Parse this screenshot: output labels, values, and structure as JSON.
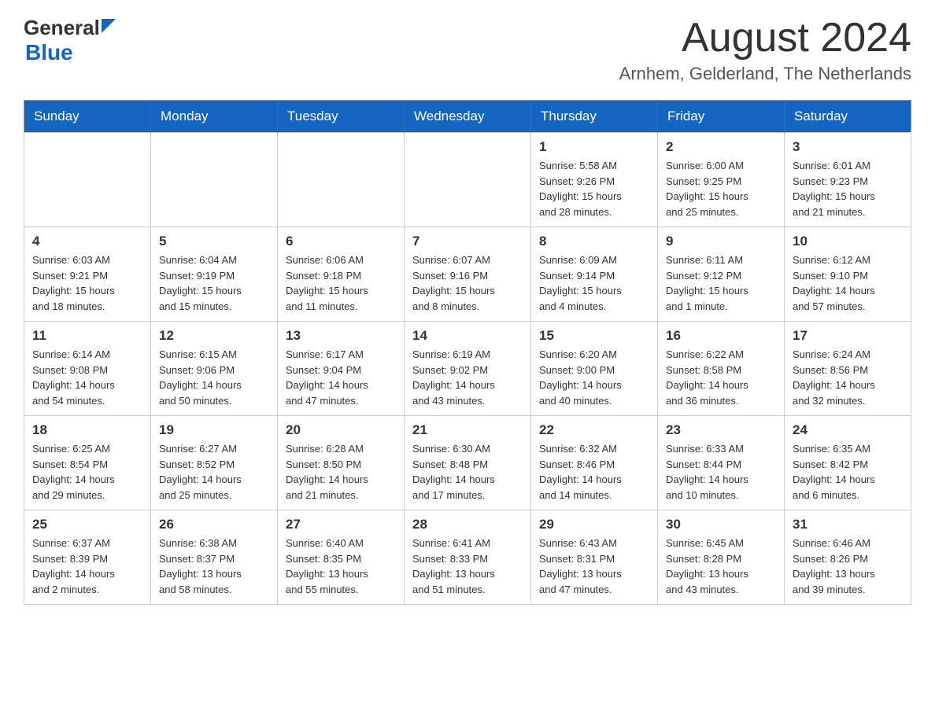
{
  "logo": {
    "general": "General",
    "blue": "Blue"
  },
  "header": {
    "month_title": "August 2024",
    "location": "Arnhem, Gelderland, The Netherlands"
  },
  "days_of_week": [
    "Sunday",
    "Monday",
    "Tuesday",
    "Wednesday",
    "Thursday",
    "Friday",
    "Saturday"
  ],
  "weeks": [
    [
      {
        "day": "",
        "info": ""
      },
      {
        "day": "",
        "info": ""
      },
      {
        "day": "",
        "info": ""
      },
      {
        "day": "",
        "info": ""
      },
      {
        "day": "1",
        "info": "Sunrise: 5:58 AM\nSunset: 9:26 PM\nDaylight: 15 hours\nand 28 minutes."
      },
      {
        "day": "2",
        "info": "Sunrise: 6:00 AM\nSunset: 9:25 PM\nDaylight: 15 hours\nand 25 minutes."
      },
      {
        "day": "3",
        "info": "Sunrise: 6:01 AM\nSunset: 9:23 PM\nDaylight: 15 hours\nand 21 minutes."
      }
    ],
    [
      {
        "day": "4",
        "info": "Sunrise: 6:03 AM\nSunset: 9:21 PM\nDaylight: 15 hours\nand 18 minutes."
      },
      {
        "day": "5",
        "info": "Sunrise: 6:04 AM\nSunset: 9:19 PM\nDaylight: 15 hours\nand 15 minutes."
      },
      {
        "day": "6",
        "info": "Sunrise: 6:06 AM\nSunset: 9:18 PM\nDaylight: 15 hours\nand 11 minutes."
      },
      {
        "day": "7",
        "info": "Sunrise: 6:07 AM\nSunset: 9:16 PM\nDaylight: 15 hours\nand 8 minutes."
      },
      {
        "day": "8",
        "info": "Sunrise: 6:09 AM\nSunset: 9:14 PM\nDaylight: 15 hours\nand 4 minutes."
      },
      {
        "day": "9",
        "info": "Sunrise: 6:11 AM\nSunset: 9:12 PM\nDaylight: 15 hours\nand 1 minute."
      },
      {
        "day": "10",
        "info": "Sunrise: 6:12 AM\nSunset: 9:10 PM\nDaylight: 14 hours\nand 57 minutes."
      }
    ],
    [
      {
        "day": "11",
        "info": "Sunrise: 6:14 AM\nSunset: 9:08 PM\nDaylight: 14 hours\nand 54 minutes."
      },
      {
        "day": "12",
        "info": "Sunrise: 6:15 AM\nSunset: 9:06 PM\nDaylight: 14 hours\nand 50 minutes."
      },
      {
        "day": "13",
        "info": "Sunrise: 6:17 AM\nSunset: 9:04 PM\nDaylight: 14 hours\nand 47 minutes."
      },
      {
        "day": "14",
        "info": "Sunrise: 6:19 AM\nSunset: 9:02 PM\nDaylight: 14 hours\nand 43 minutes."
      },
      {
        "day": "15",
        "info": "Sunrise: 6:20 AM\nSunset: 9:00 PM\nDaylight: 14 hours\nand 40 minutes."
      },
      {
        "day": "16",
        "info": "Sunrise: 6:22 AM\nSunset: 8:58 PM\nDaylight: 14 hours\nand 36 minutes."
      },
      {
        "day": "17",
        "info": "Sunrise: 6:24 AM\nSunset: 8:56 PM\nDaylight: 14 hours\nand 32 minutes."
      }
    ],
    [
      {
        "day": "18",
        "info": "Sunrise: 6:25 AM\nSunset: 8:54 PM\nDaylight: 14 hours\nand 29 minutes."
      },
      {
        "day": "19",
        "info": "Sunrise: 6:27 AM\nSunset: 8:52 PM\nDaylight: 14 hours\nand 25 minutes."
      },
      {
        "day": "20",
        "info": "Sunrise: 6:28 AM\nSunset: 8:50 PM\nDaylight: 14 hours\nand 21 minutes."
      },
      {
        "day": "21",
        "info": "Sunrise: 6:30 AM\nSunset: 8:48 PM\nDaylight: 14 hours\nand 17 minutes."
      },
      {
        "day": "22",
        "info": "Sunrise: 6:32 AM\nSunset: 8:46 PM\nDaylight: 14 hours\nand 14 minutes."
      },
      {
        "day": "23",
        "info": "Sunrise: 6:33 AM\nSunset: 8:44 PM\nDaylight: 14 hours\nand 10 minutes."
      },
      {
        "day": "24",
        "info": "Sunrise: 6:35 AM\nSunset: 8:42 PM\nDaylight: 14 hours\nand 6 minutes."
      }
    ],
    [
      {
        "day": "25",
        "info": "Sunrise: 6:37 AM\nSunset: 8:39 PM\nDaylight: 14 hours\nand 2 minutes."
      },
      {
        "day": "26",
        "info": "Sunrise: 6:38 AM\nSunset: 8:37 PM\nDaylight: 13 hours\nand 58 minutes."
      },
      {
        "day": "27",
        "info": "Sunrise: 6:40 AM\nSunset: 8:35 PM\nDaylight: 13 hours\nand 55 minutes."
      },
      {
        "day": "28",
        "info": "Sunrise: 6:41 AM\nSunset: 8:33 PM\nDaylight: 13 hours\nand 51 minutes."
      },
      {
        "day": "29",
        "info": "Sunrise: 6:43 AM\nSunset: 8:31 PM\nDaylight: 13 hours\nand 47 minutes."
      },
      {
        "day": "30",
        "info": "Sunrise: 6:45 AM\nSunset: 8:28 PM\nDaylight: 13 hours\nand 43 minutes."
      },
      {
        "day": "31",
        "info": "Sunrise: 6:46 AM\nSunset: 8:26 PM\nDaylight: 13 hours\nand 39 minutes."
      }
    ]
  ]
}
